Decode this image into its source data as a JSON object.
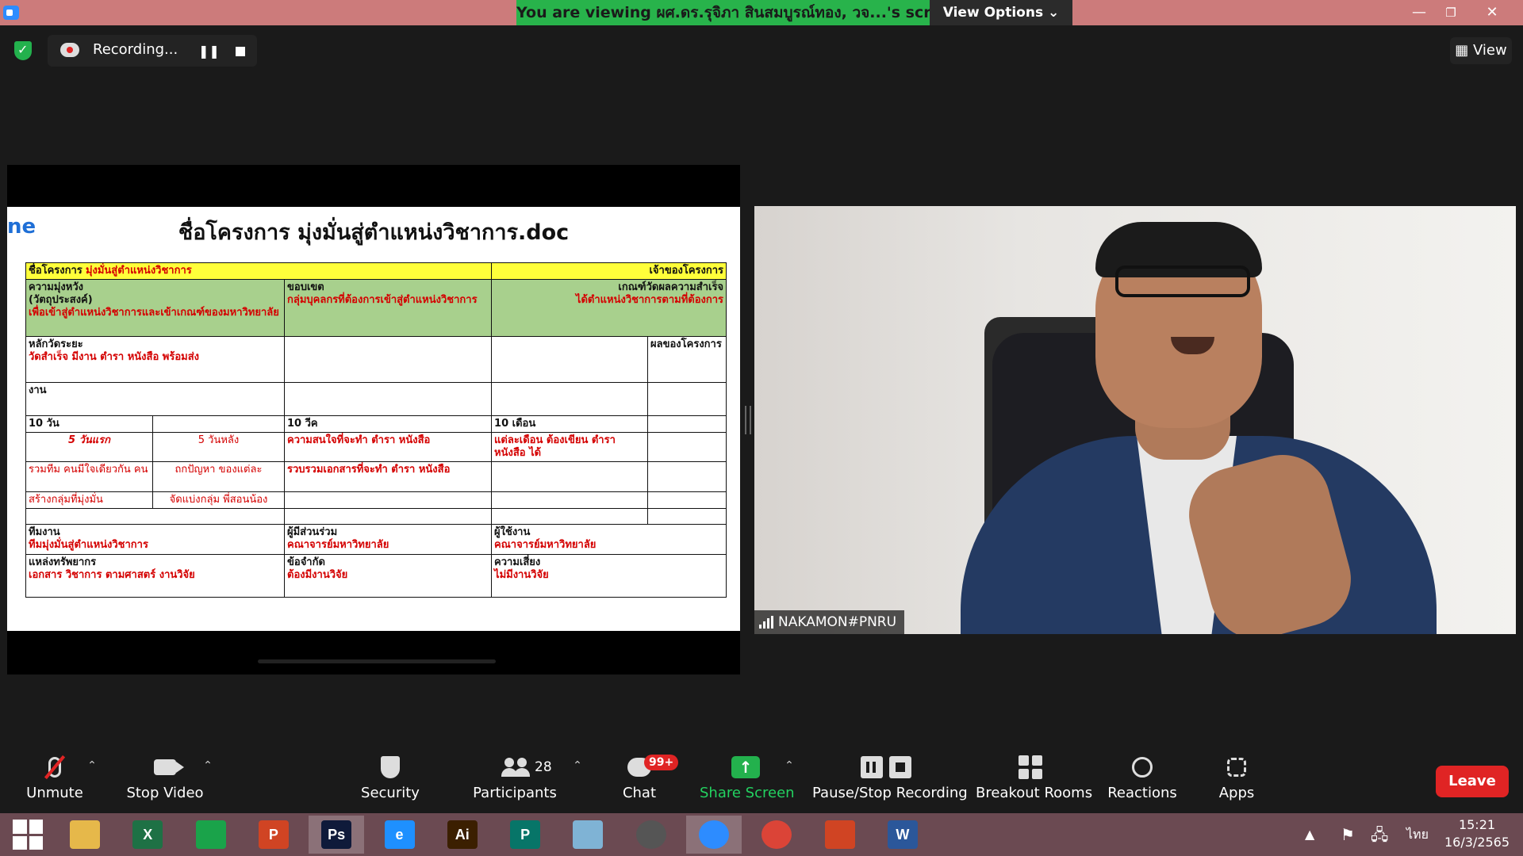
{
  "titlebar": {
    "viewing_banner": "You are viewing ผศ.ดร.รุจิภา สินสมบูรณ์ทอง, วจ...'s screen",
    "view_options_label": "View Options ⌄",
    "minimize_icon": "minimize-icon",
    "restore_icon": "restore-icon",
    "close_icon": "close-icon"
  },
  "recording": {
    "label": "Recording...",
    "pause_icon": "pause-icon",
    "stop_icon": "stop-icon"
  },
  "view_button_label": "View",
  "shared_doc": {
    "tag_text": "ne",
    "title": "ชื่อโครงการ มุ่งมั่นสู่ตำแหน่งวิชาการ.doc",
    "rows": {
      "project_label": "ชื่อโครงการ",
      "project_value": "มุ่งมั่นสู่ตำแหน่งวิชาการ",
      "owner_label": "เจ้าของโครงการ",
      "goal_label": "ความมุ่งหวัง",
      "goal_sub": "(วัตถุประสงค์)",
      "goal_value": "เพื่อเข้าสู่ตำแหน่งวิชาการและเข้าเกณฑ์ของมหาวิทยาลัย",
      "scope_label": "ขอบเขต",
      "scope_value": "กลุ่มบุคลกรที่ต้องการเข้าสู่ตำแหน่งวิชาการ",
      "criteria_label": "เกณฑ์วัดผลความสำเร็จ",
      "criteria_value": "ได้ตำแหน่งวิชาการตามที่ต้องการ",
      "milestone_label": "หลักวัดระยะ",
      "milestone_value": "วัดสำเร็จ มีงาน ตำรา หนังสือ พร้อมส่ง",
      "result_label": "ผลของโครงการ",
      "work_label": "งาน",
      "d10": "10 วัน",
      "w10": "10 วีค",
      "m10": "10 เดือน",
      "first5": "5 วันแรก",
      "last5": "5 วันหลัง",
      "weekly_goal": "ความสนใจที่จะทำ ตำรา หนังสือ",
      "monthly_goal": "แต่ละเดือน ต้องเขียน ตำรา หนังสือ ได้",
      "team_gather": "รวมทีม คนมีใจเดียวกัน คน",
      "problem": "ถกปัญหา ของแต่ละ",
      "collect_docs": "รวบรวมเอกสารที่จะทำ ตำรา หนังสือ",
      "build_group": "สร้างกลุ่มที่มุ่งมั่น",
      "split_group": "จัดแบ่งกลุ่ม พี่สอนน้อง",
      "team_label": "ทีมงาน",
      "team_value": "ทีมมุ่งมั่นสู่ตำแหน่งวิชาการ",
      "stake_label": "ผู้มีส่วนร่วม",
      "stake_value": "คณาจารย์มหาวิทยาลัย",
      "user_label": "ผู้ใช้งาน",
      "user_value": "คณาจารย์มหาวิทยาลัย",
      "resource_label": "แหล่งทรัพยากร",
      "resource_value": "เอกสาร วิชาการ ตามศาสตร์ งานวิจัย",
      "limit_label": "ข้อจำกัด",
      "limit_value": "ต้องมีงานวิจัย",
      "risk_label": "ความเสี่ยง",
      "risk_value": "ไม่มีงานวิจัย"
    }
  },
  "video": {
    "participant_name": "NAKAMON#PNRU"
  },
  "toolbar": {
    "unmute": "Unmute",
    "stop_video": "Stop Video",
    "security": "Security",
    "participants": "Participants",
    "participants_count": "28",
    "chat": "Chat",
    "chat_badge": "99+",
    "share_screen": "Share Screen",
    "pause_stop_recording": "Pause/Stop Recording",
    "breakout_rooms": "Breakout Rooms",
    "reactions": "Reactions",
    "apps": "Apps",
    "leave": "Leave"
  },
  "taskbar": {
    "apps": [
      {
        "name": "file-explorer",
        "glyph": "",
        "color": "#e6b84a"
      },
      {
        "name": "excel",
        "glyph": "X",
        "color": "#1e7145"
      },
      {
        "name": "store",
        "glyph": "",
        "color": "#1aa34a"
      },
      {
        "name": "powerpoint",
        "glyph": "P",
        "color": "#d04423"
      },
      {
        "name": "photoshop",
        "glyph": "Ps",
        "color": "#0f1a3a"
      },
      {
        "name": "internet-explorer",
        "glyph": "e",
        "color": "#1e90ff"
      },
      {
        "name": "illustrator",
        "glyph": "Ai",
        "color": "#3b1f00"
      },
      {
        "name": "publisher",
        "glyph": "P",
        "color": "#077568"
      },
      {
        "name": "notepad",
        "glyph": "",
        "color": "#7fb3d5"
      },
      {
        "name": "photoscape",
        "glyph": "",
        "color": "#555555"
      },
      {
        "name": "zoom",
        "glyph": "",
        "color": "#2d8cff"
      },
      {
        "name": "chrome",
        "glyph": "",
        "color": "#db4437"
      },
      {
        "name": "ppt-slideshow",
        "glyph": "",
        "color": "#d04423"
      },
      {
        "name": "word",
        "glyph": "W",
        "color": "#2b579a"
      }
    ],
    "language": "ไทย",
    "time": "15:21",
    "date": "16/3/2565"
  }
}
